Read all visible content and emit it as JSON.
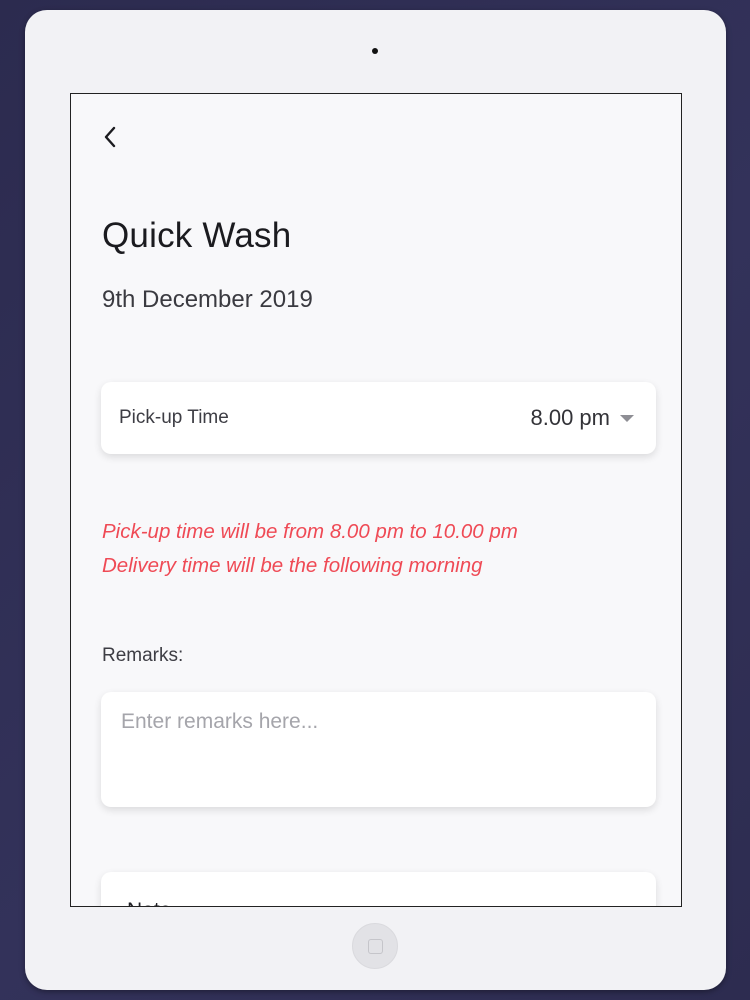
{
  "header": {
    "back_icon": "chevron-left-icon"
  },
  "service": {
    "title": "Quick Wash",
    "date": "9th December 2019"
  },
  "pickup": {
    "label": "Pick-up Time",
    "selected_value": "8.00 pm",
    "dropdown_icon": "caret-down-icon"
  },
  "notice": {
    "line1": "Pick-up time will be from 8.00 pm to 10.00 pm",
    "line2": "Delivery time will be the following morning",
    "color": "#ef4a55"
  },
  "remarks": {
    "label": "Remarks:",
    "placeholder": "Enter remarks here..."
  },
  "note": {
    "label": "Note"
  }
}
